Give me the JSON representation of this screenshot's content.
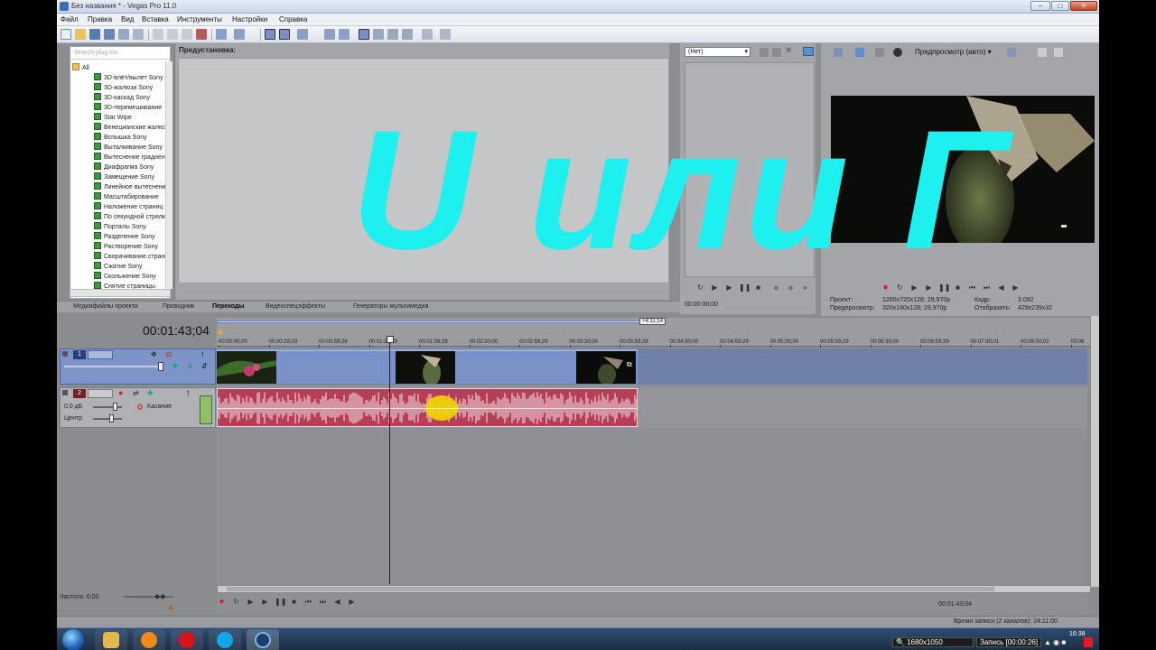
{
  "window": {
    "title": "Без названия * - Vegas Pro 11.0",
    "controls": {
      "minimize": "–",
      "maximize": "□",
      "close": "✕"
    }
  },
  "menu": [
    "Файл",
    "Правка",
    "Вид",
    "Вставка",
    "Инструменты",
    "Настройки",
    "Справка"
  ],
  "plugin_browser": {
    "search_placeholder": "Search plug-ins",
    "root_label": "All",
    "items": [
      "3D-влёт/вылет Sony",
      "3D-жалюзи Sony",
      "3D-каскад Sony",
      "3D-перемешивание",
      "Star Wipe",
      "Венецианские жалюзи",
      "Вспышка Sony",
      "Выталкивание Sony",
      "Вытеснение градиентом",
      "Диафрагма Sony",
      "Замещение Sony",
      "Линейное вытеснение",
      "Масштабирование",
      "Наложение страниц",
      "По секундной стрелке",
      "Порталы Sony",
      "Разделение Sony",
      "Растворение Sony",
      "Сворачивание страниц",
      "Сжатие Sony",
      "Скольжение Sony",
      "Снятие страницы"
    ]
  },
  "preset": {
    "label": "Предустановка:"
  },
  "dock_tabs": [
    "Медиафайлы проекта",
    "Проводник",
    "Переходы",
    "Видеоспецэффекты",
    "Генераторы мультимедиа"
  ],
  "transition_preview": {
    "dropdown_value": "(Нет)",
    "time": "00:00:00;00"
  },
  "video_preview": {
    "mode_label": "Предпросмотр (авто)",
    "info": {
      "project_label": "Проект:",
      "project_value": "1280x720x128; 29,970p",
      "preview_label": "Предпросмотр:",
      "preview_value": "320x180x128; 29,970p",
      "frame_label": "Кадр:",
      "frame_value": "3 092",
      "display_label": "Отобразить:",
      "display_value": "429x239x32"
    }
  },
  "overlay_caption": "U или Г",
  "timeline": {
    "current_time": "00:01:43;04",
    "loop_marker": "+4:11;14",
    "ruler_labels": [
      "00:00:00;00",
      "00:00:29;29",
      "00:00:59;28",
      "00:01:29;29",
      "00:01:59;28",
      "00:02:30;00",
      "00:02:59;29",
      "00:03:30;00",
      "00:03:59;29",
      "00:04:30;00",
      "00:04:59;29",
      "00:05:30;00",
      "00:05:59;29",
      "00:06:30;00",
      "00:06:59;29",
      "00:07:30;01",
      "00:08:00;02",
      "00:08"
    ],
    "video_track": {
      "number": "1"
    },
    "audio_track": {
      "number": "2",
      "volume": "0,0 дБ",
      "mode": "Касание",
      "pan": "Центр"
    },
    "rate": "Частота: 0,00",
    "end_time": "00:01:43;04",
    "status": "Время записи (2 каналов): 24:11:00"
  },
  "taskbar": {
    "resolution": "1680x1050",
    "recording": "Запись [00:00:26]",
    "clock": "16:38"
  },
  "colors": {
    "overlay": "#1ef0ef",
    "video_track": "#7c94c8",
    "audio_clip": "#b73f55"
  }
}
